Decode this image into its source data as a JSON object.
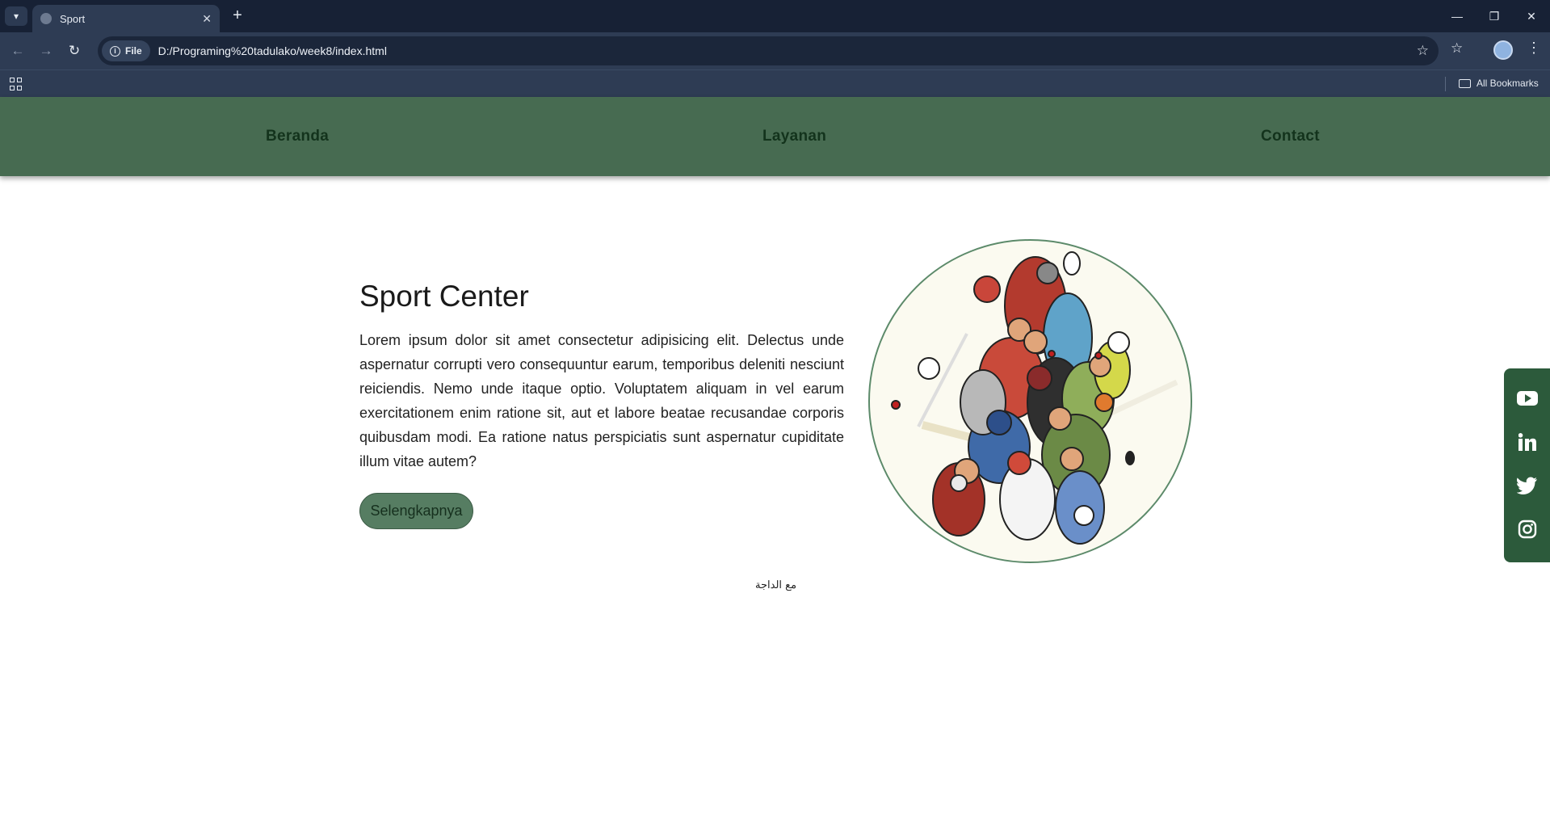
{
  "browser": {
    "tab_title": "Sport",
    "site_chip": "File",
    "url": "D:/Programing%20tadulako/week8/index.html",
    "all_bookmarks": "All Bookmarks"
  },
  "nav": {
    "items": [
      {
        "label": "Beranda"
      },
      {
        "label": "Layanan"
      },
      {
        "label": "Contact"
      }
    ]
  },
  "hero": {
    "title": "Sport Center",
    "text": "Lorem ipsum dolor sit amet consectetur adipisicing elit. Delectus unde aspernatur corrupti vero consequuntur earum, temporibus deleniti nesciunt reiciendis. Nemo unde itaque optio. Voluptatem aliquam in vel earum exercitationem enim ratione sit, aut et labore beatae recusandae corporis quibusdam modi. Ea ratione natus perspiciatis sunt aspernatur cupiditate illum vitae autem?",
    "button_label": "Selengkapnya",
    "image_icon": "sports-players-illustration"
  },
  "footer": {
    "text": "مع الداجة"
  },
  "social": {
    "icons": [
      "youtube-icon",
      "linkedin-icon",
      "twitter-icon",
      "instagram-icon"
    ]
  },
  "colors": {
    "chrome_dark": "#172135",
    "chrome": "#2e3c54",
    "nav_green": "#476b51",
    "social_green": "#2c5a3b",
    "button_green": "#567d62"
  }
}
